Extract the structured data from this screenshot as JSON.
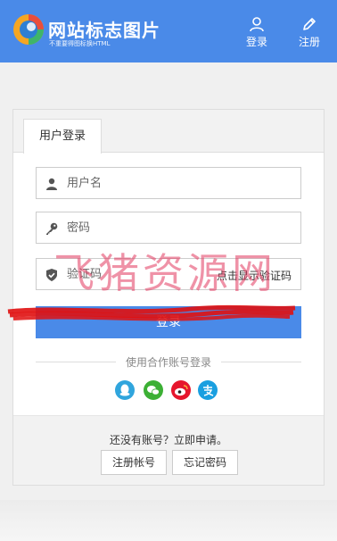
{
  "header": {
    "site_title": "网站标志图片",
    "site_subtitle": "不重要得图标换HTML",
    "nav": {
      "login_label": "登录",
      "register_label": "注册"
    }
  },
  "login_form": {
    "tab_label": "用户登录",
    "username_placeholder": "用户名",
    "password_placeholder": "密码",
    "captcha_placeholder": "验证码",
    "captcha_link": "点击显示验证码",
    "submit_label": "登录"
  },
  "social": {
    "divider_text": "使用合作账号登录",
    "providers": [
      "qq-icon",
      "wechat-icon",
      "weibo-icon",
      "alipay-icon"
    ]
  },
  "footer_panel": {
    "no_account_text": "还没有账号？立即申请。",
    "register_button": "注册帐号",
    "forgot_button": "忘记密码"
  },
  "watermark": "飞猪资源网",
  "colors": {
    "header_blue": "#4a8ae8",
    "watermark": "#e23a60"
  }
}
